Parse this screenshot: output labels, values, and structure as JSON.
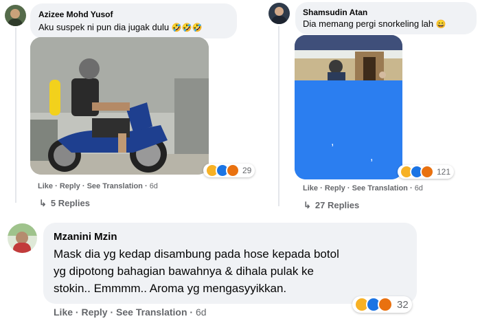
{
  "comment1": {
    "author": "Azizee Mohd Yusof",
    "text": "Aku suspek ni pun dia jugak dulu",
    "emojis": "🤣🤣🤣",
    "reaction_count": "29",
    "actions": {
      "like": "Like",
      "reply": "Reply",
      "translate": "See Translation",
      "time": "6d"
    },
    "replies": "5 Replies"
  },
  "comment2": {
    "author": "Shamsudin Atan",
    "text": "Dia memang pergi snorkeling lah",
    "emojis": "😄",
    "reaction_count": "121",
    "actions": {
      "like": "Like",
      "reply": "Reply",
      "translate": "See Translation",
      "time": "6d"
    },
    "replies": "27 Replies"
  },
  "comment3": {
    "author": "Mzanini Mzin",
    "text_lines": [
      "Mask dia yg kedap disambung pada hose kepada botol",
      "yg dipotong bahagian bawahnya & dihala pulak ke",
      "stokin.. Emmmm.. Aroma yg mengasyyikkan."
    ],
    "reaction_count": "32",
    "actions": {
      "like": "Like",
      "reply": "Reply",
      "translate": "See Translation",
      "time": "6d"
    }
  },
  "colors": {
    "bubble": "#f0f2f5",
    "meta": "#65676b",
    "like_blue": "#1b74e4",
    "haha": "#f7b125",
    "angry": "#e9710f"
  },
  "icons": {
    "reply_arrow": "↳",
    "separator": "·"
  }
}
